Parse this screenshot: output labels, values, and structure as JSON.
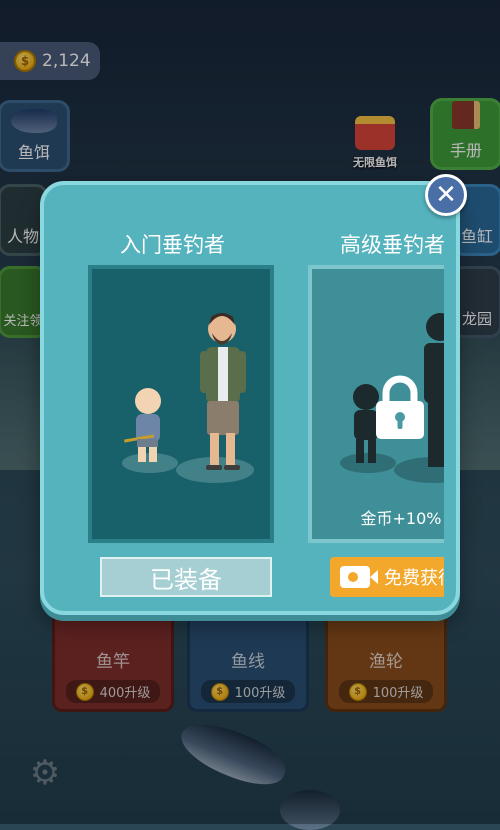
{
  "hud": {
    "coins": "2,124"
  },
  "left_menu": [
    {
      "label": "鱼饵"
    },
    {
      "label": "人物"
    },
    {
      "label": "关注领"
    }
  ],
  "right_menu": [
    {
      "label": "手册"
    },
    {
      "label": "鱼缸"
    },
    {
      "label": "龙园"
    }
  ],
  "bait_promo": {
    "label": "无限鱼饵"
  },
  "modal": {
    "characters": [
      {
        "title": "入门垂钓者",
        "button": "已装备"
      },
      {
        "title": "高级垂钓者",
        "bonus": "金币+10%",
        "button": "免费获得"
      }
    ]
  },
  "upgrades": [
    {
      "label": "鱼竿",
      "cost": "400升级"
    },
    {
      "label": "鱼线",
      "cost": "100升级"
    },
    {
      "label": "渔轮",
      "cost": "100升级"
    }
  ],
  "colors": {
    "modal_bg": "#55b3be",
    "accent_orange": "#f3a82c",
    "close_button": "#4a6ea6"
  },
  "icons": [
    "coin-icon",
    "close-icon",
    "lock-icon",
    "video-icon",
    "gear-icon"
  ]
}
